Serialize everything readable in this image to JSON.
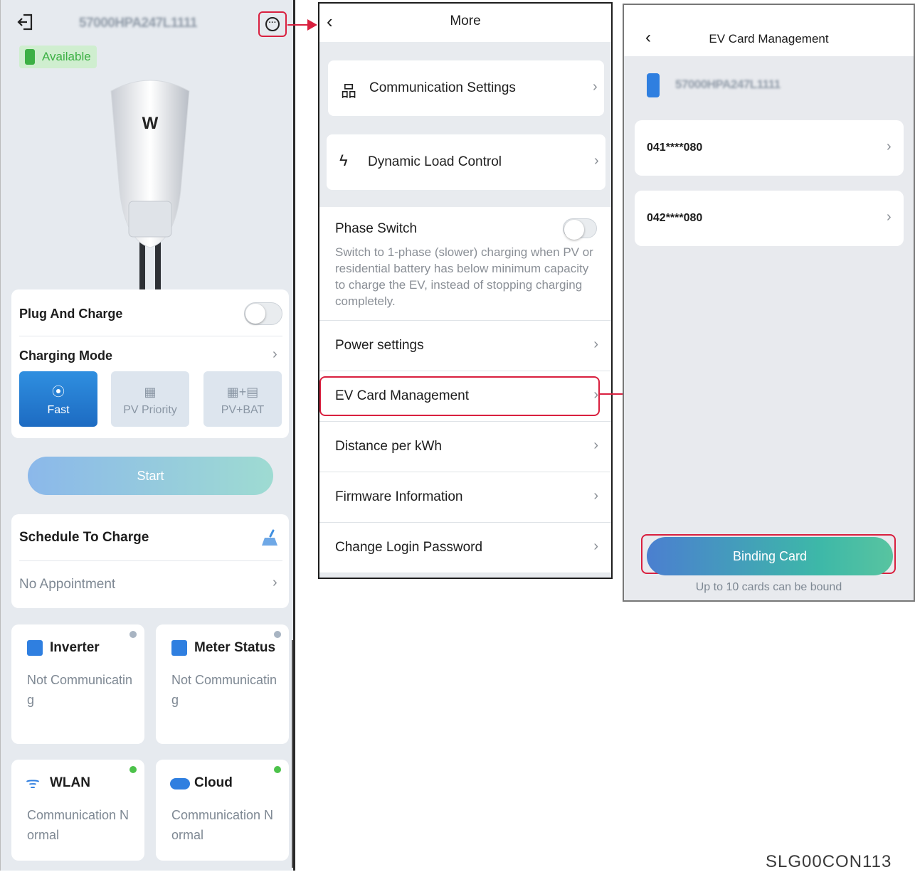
{
  "screen1": {
    "device_serial": "57000HPA247L1111",
    "status_badge": "Available",
    "plug_and_charge": {
      "label": "Plug And Charge"
    },
    "charging_mode": {
      "label": "Charging Mode",
      "modes": [
        {
          "label": "Fast",
          "icon": "plug-icon"
        },
        {
          "label": "PV Priority",
          "icon": "solar-panel-icon"
        },
        {
          "label": "PV+BAT",
          "icon": "solar-battery-icon"
        }
      ]
    },
    "start_button": "Start",
    "schedule": {
      "title": "Schedule To Charge",
      "value": "No Appointment"
    },
    "tiles": [
      {
        "title": "Inverter",
        "status": "Not Communicating",
        "dot_color": "#a8b4c2"
      },
      {
        "title": "Meter Status",
        "status": "Not Communicating",
        "dot_color": "#a8b4c2"
      },
      {
        "title": "WLAN",
        "status": "Communication Normal",
        "dot_color": "#4cc24a"
      },
      {
        "title": "Cloud",
        "status": "Communication Normal",
        "dot_color": "#4cc24a"
      }
    ]
  },
  "screen2": {
    "title": "More",
    "items": {
      "communication_settings": "Communication Settings",
      "dynamic_load_control": "Dynamic Load Control",
      "phase_switch": "Phase Switch",
      "phase_switch_desc": "Switch to 1-phase (slower) charging when PV or residential battery has below minimum capacity to charge the EV, instead of stopping charging completely.",
      "power_settings": "Power settings",
      "ev_card_management": "EV Card Management",
      "distance_per_kwh": "Distance per kWh",
      "firmware_information": "Firmware Information",
      "change_login_password": "Change Login Password"
    }
  },
  "screen3": {
    "title": "EV Card Management",
    "device_serial": "57000HPA247L1111",
    "cards": [
      "041****080",
      "042****080"
    ],
    "binding_button": "Binding Card",
    "binding_note": "Up to 10 cards can be bound"
  },
  "document_code": "SLG00CON113",
  "colors": {
    "highlight": "#d9203f",
    "accent_blue": "#1d6bc2",
    "status_green": "#3cb044"
  }
}
